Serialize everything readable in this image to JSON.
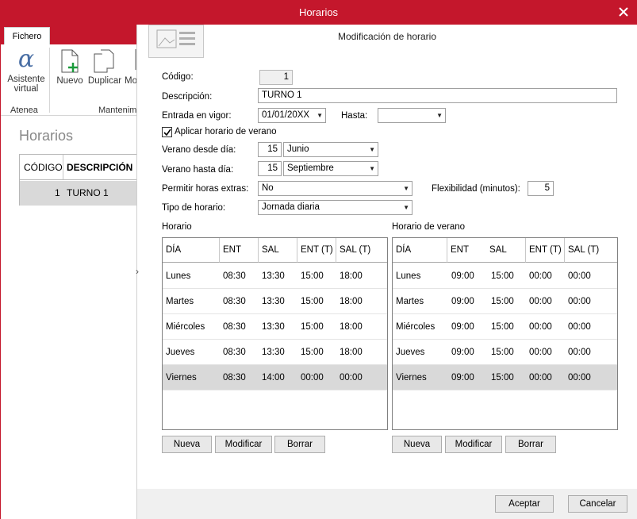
{
  "window": {
    "title": "Horarios"
  },
  "background": {
    "ribbon_tab": "Fichero",
    "assistant_label_1": "Asistente",
    "assistant_label_2": "virtual",
    "new_label": "Nuevo",
    "duplicate_label": "Duplicar",
    "modify_partial": "Mo",
    "group_atenea": "Atenea",
    "group_maint": "Mantenim",
    "list_title": "Horarios",
    "columns": [
      "CÓDIGO",
      "DESCRIPCIÓN"
    ],
    "rows": [
      {
        "code": "1",
        "desc": "TURNO 1"
      }
    ]
  },
  "dialog": {
    "title": "Modificación de horario",
    "codigo_label": "Código:",
    "codigo_value": "1",
    "descripcion_label": "Descripción:",
    "descripcion_value": "TURNO 1",
    "entrada_label": "Entrada en vigor:",
    "entrada_value": "01/01/20XX",
    "hasta_label": "Hasta:",
    "hasta_value": "",
    "verano_checkbox_label": "Aplicar horario de verano",
    "verano_checked": true,
    "desde_label": "Verano desde día:",
    "desde_day": "15",
    "desde_month": "Junio",
    "hasta_dia_label": "Verano hasta día:",
    "hasta_day": "15",
    "hasta_month": "Septiembre",
    "extras_label": "Permitir horas extras:",
    "extras_value": "No",
    "flex_label": "Flexibilidad (minutos):",
    "flex_value": "5",
    "tipo_label": "Tipo de horario:",
    "tipo_value": "Jornada diaria",
    "horario_title": "Horario",
    "verano_title": "Horario de verano",
    "columns": [
      "DÍA",
      "ENT",
      "SAL",
      "ENT (T)",
      "SAL (T)"
    ],
    "horario_rows": [
      [
        "Lunes",
        "08:30",
        "13:30",
        "15:00",
        "18:00"
      ],
      [
        "Martes",
        "08:30",
        "13:30",
        "15:00",
        "18:00"
      ],
      [
        "Miércoles",
        "08:30",
        "13:30",
        "15:00",
        "18:00"
      ],
      [
        "Jueves",
        "08:30",
        "13:30",
        "15:00",
        "18:00"
      ],
      [
        "Viernes",
        "08:30",
        "14:00",
        "00:00",
        "00:00"
      ]
    ],
    "verano_rows": [
      [
        "Lunes",
        "09:00",
        "15:00",
        "00:00",
        "00:00"
      ],
      [
        "Martes",
        "09:00",
        "15:00",
        "00:00",
        "00:00"
      ],
      [
        "Miércoles",
        "09:00",
        "15:00",
        "00:00",
        "00:00"
      ],
      [
        "Jueves",
        "09:00",
        "15:00",
        "00:00",
        "00:00"
      ],
      [
        "Viernes",
        "09:00",
        "15:00",
        "00:00",
        "00:00"
      ]
    ],
    "btn_nueva": "Nueva",
    "btn_modificar": "Modificar",
    "btn_borrar": "Borrar",
    "btn_aceptar": "Aceptar",
    "btn_cancelar": "Cancelar",
    "close_icon": "×"
  }
}
